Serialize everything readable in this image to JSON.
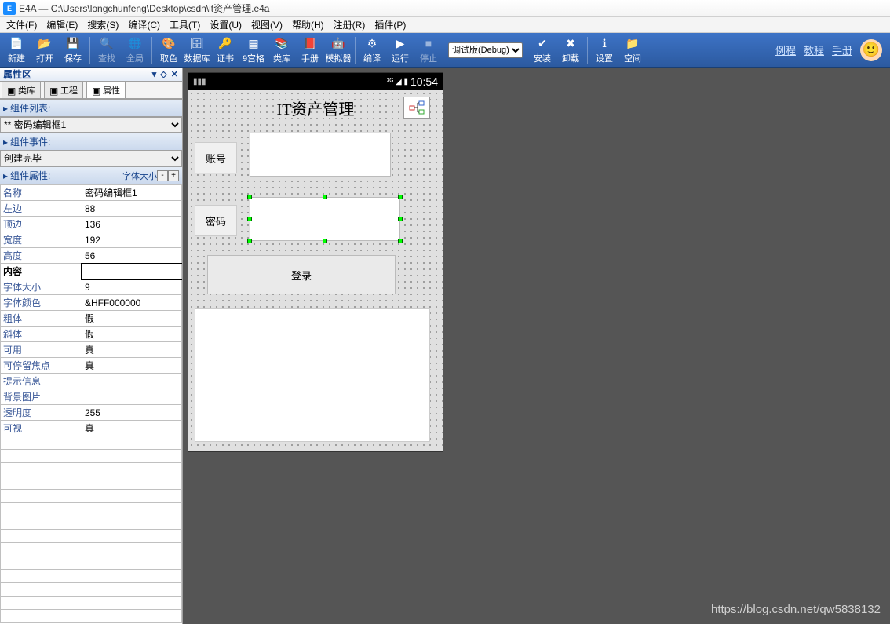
{
  "window": {
    "title": "E4A — C:\\Users\\longchunfeng\\Desktop\\csdn\\it资产管理.e4a"
  },
  "menu": [
    "文件(F)",
    "编辑(E)",
    "搜索(S)",
    "编译(C)",
    "工具(T)",
    "设置(U)",
    "视图(V)",
    "帮助(H)",
    "注册(R)",
    "插件(P)"
  ],
  "toolbar": {
    "items": [
      {
        "label": "新建",
        "icon": "📄"
      },
      {
        "label": "打开",
        "icon": "📂"
      },
      {
        "label": "保存",
        "icon": "💾"
      },
      {
        "sep": true
      },
      {
        "label": "查找",
        "icon": "🔍",
        "disabled": true
      },
      {
        "label": "全局",
        "icon": "🌐",
        "disabled": true
      },
      {
        "sep": true
      },
      {
        "label": "取色",
        "icon": "🎨"
      },
      {
        "label": "数据库",
        "icon": "🗄"
      },
      {
        "label": "证书",
        "icon": "🔑"
      },
      {
        "label": "9宫格",
        "icon": "▦"
      },
      {
        "label": "类库",
        "icon": "📚"
      },
      {
        "label": "手册",
        "icon": "📕"
      },
      {
        "label": "模拟器",
        "icon": "🤖"
      },
      {
        "sep": true
      },
      {
        "label": "编译",
        "icon": "⚙"
      },
      {
        "label": "运行",
        "icon": "▶"
      },
      {
        "label": "停止",
        "icon": "■",
        "disabled": true
      }
    ],
    "build_mode": "调试版(Debug)",
    "items2": [
      {
        "label": "安装",
        "icon": "✔"
      },
      {
        "label": "卸载",
        "icon": "✖"
      },
      {
        "sep": true
      },
      {
        "label": "设置",
        "icon": "ℹ"
      },
      {
        "label": "空间",
        "icon": "📁"
      }
    ],
    "links": [
      "例程",
      "教程",
      "手册"
    ]
  },
  "panel": {
    "title": "属性区",
    "tabs": [
      "类库",
      "工程",
      "属性"
    ],
    "active_tab": 2,
    "component_list_label": "组件列表:",
    "component_selected": "** 密码编辑框1",
    "component_events_label": "组件事件:",
    "event_selected": "创建完毕",
    "component_props_label": "组件属性:",
    "props_right": "字体大小",
    "rows": [
      {
        "k": "名称",
        "v": "密码编辑框1"
      },
      {
        "k": "左边",
        "v": "88"
      },
      {
        "k": "顶边",
        "v": "136"
      },
      {
        "k": "宽度",
        "v": "192"
      },
      {
        "k": "高度",
        "v": "56"
      },
      {
        "k": "内容",
        "v": "",
        "bold": true,
        "sel": true
      },
      {
        "k": "字体大小",
        "v": "9"
      },
      {
        "k": "字体颜色",
        "v": "&HFF000000"
      },
      {
        "k": "粗体",
        "v": "假"
      },
      {
        "k": "斜体",
        "v": "假"
      },
      {
        "k": "可用",
        "v": "真"
      },
      {
        "k": "可停留焦点",
        "v": "真"
      },
      {
        "k": "提示信息",
        "v": ""
      },
      {
        "k": "背景图片",
        "v": ""
      },
      {
        "k": "透明度",
        "v": "255"
      },
      {
        "k": "可视",
        "v": "真"
      }
    ]
  },
  "phone": {
    "time": "10:54",
    "title": "IT资产管理",
    "account_label": "账号",
    "password_label": "密码",
    "login_label": "登录"
  },
  "watermark": "https://blog.csdn.net/qw5838132"
}
